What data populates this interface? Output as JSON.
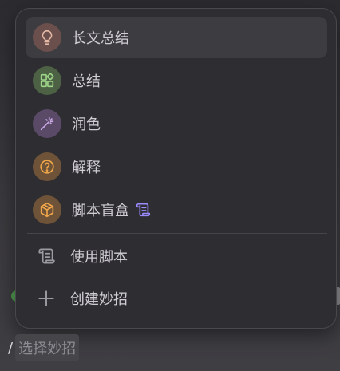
{
  "menu": {
    "items": [
      {
        "label": "长文总结",
        "icon": "lightbulb-icon",
        "icon_bg": "#6b4f4c",
        "icon_color": "#e3b9a6",
        "active": true
      },
      {
        "label": "总结",
        "icon": "grid-plus-icon",
        "icon_bg": "#4d6244",
        "icon_color": "#9fd58a",
        "active": false
      },
      {
        "label": "润色",
        "icon": "magic-wand-icon",
        "icon_bg": "#5a4a67",
        "icon_color": "#c9a9e6",
        "active": false
      },
      {
        "label": "解释",
        "icon": "question-circle-icon",
        "icon_bg": "#6e5338",
        "icon_color": "#f0a64a",
        "active": false
      },
      {
        "label": "脚本盲盒",
        "icon": "box-icon",
        "icon_bg": "#6e5338",
        "icon_color": "#f0a64a",
        "badge_icon": "scroll-icon",
        "badge_color": "#9a8bff",
        "active": false
      }
    ],
    "actions": [
      {
        "label": "使用脚本",
        "icon": "scroll-icon"
      },
      {
        "label": "创建妙招",
        "icon": "plus-icon"
      }
    ]
  },
  "input": {
    "prefix": "/",
    "placeholder": "选择妙招"
  }
}
